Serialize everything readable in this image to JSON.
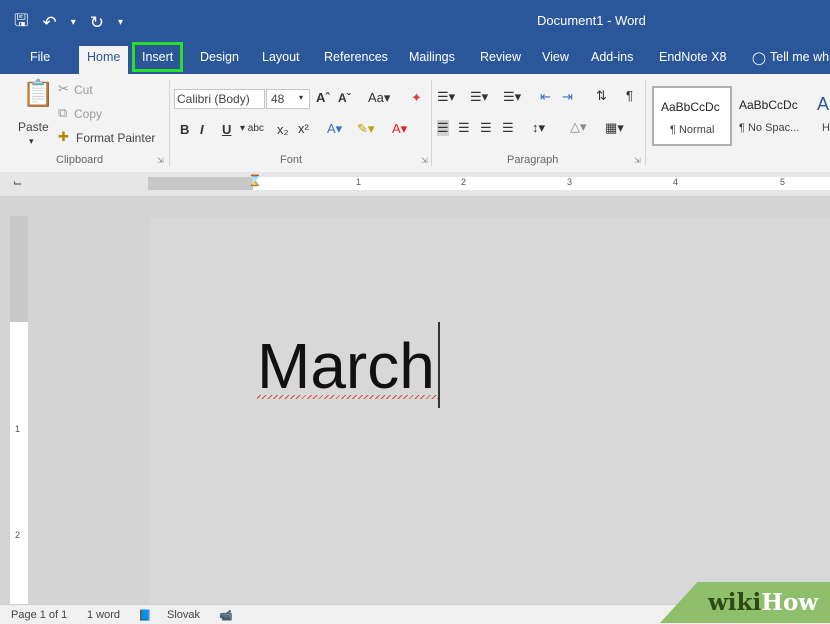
{
  "app": {
    "document_title": "Document1  -  Word"
  },
  "tabs": {
    "file": "File",
    "home": "Home",
    "insert": "Insert",
    "design": "Design",
    "layout": "Layout",
    "references": "References",
    "mailings": "Mailings",
    "review": "Review",
    "view": "View",
    "addins": "Add-ins",
    "endnote": "EndNote X8",
    "tellme": "Tell me wh"
  },
  "ribbon": {
    "clipboard": {
      "paste": "Paste",
      "cut": "Cut",
      "copy": "Copy",
      "format_painter": "Format Painter",
      "label": "Clipboard"
    },
    "font": {
      "name": "Calibri (Body)",
      "size": "48",
      "label": "Font"
    },
    "paragraph": {
      "label": "Paragraph"
    },
    "styles": {
      "preview1": "AaBbCcDc",
      "name1": "¶ Normal",
      "preview2": "AaBbCcDc",
      "name2": "¶ No Spac...",
      "preview3": "A",
      "name3": "H"
    }
  },
  "ruler": {
    "n1": "1",
    "n2": "2",
    "n3": "3",
    "n4": "4",
    "n5": "5"
  },
  "vruler": {
    "n1": "1",
    "n2": "2"
  },
  "document": {
    "text": "March"
  },
  "status": {
    "page": "Page 1 of 1",
    "words": "1 word",
    "language": "Slovak"
  },
  "watermark": {
    "wiki": "wiki",
    "how": "How"
  }
}
